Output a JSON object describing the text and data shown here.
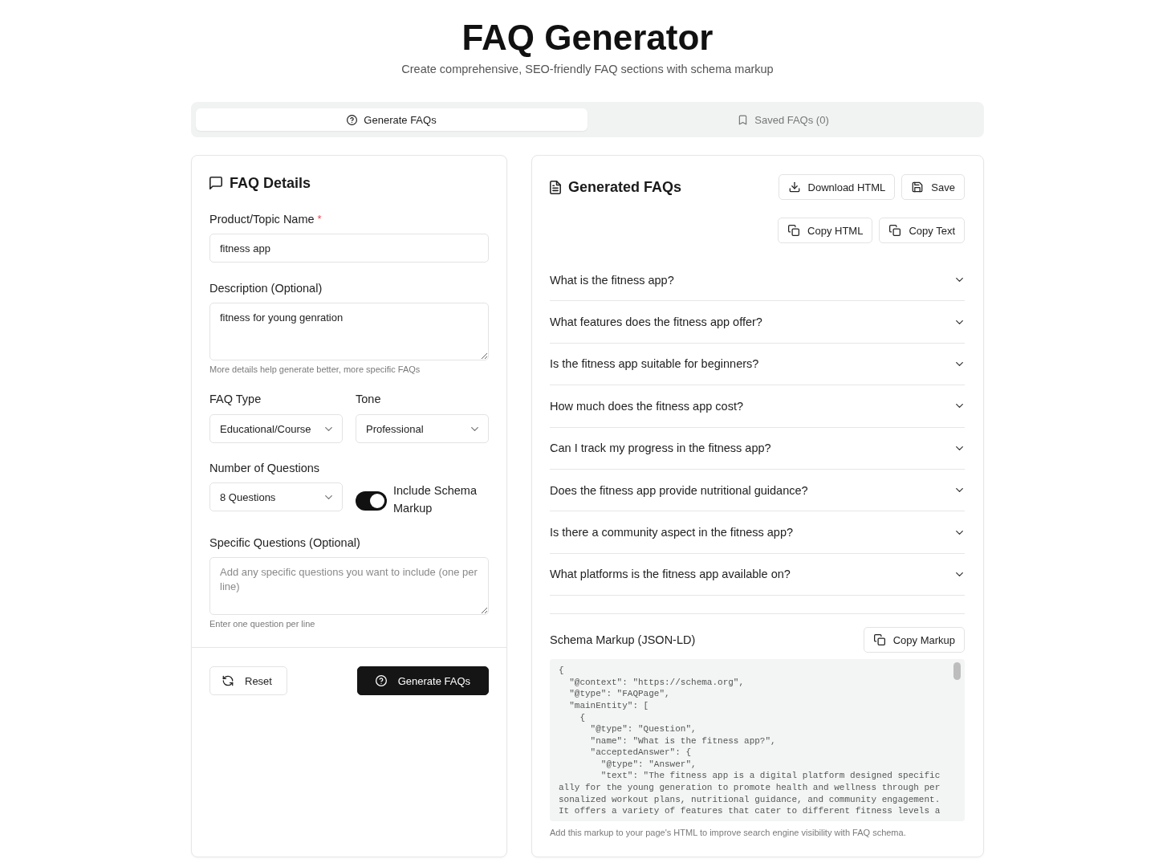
{
  "header": {
    "title": "FAQ Generator",
    "subtitle": "Create comprehensive, SEO-friendly FAQ sections with schema markup"
  },
  "tabs": [
    {
      "label": "Generate FAQs",
      "selected": true
    },
    {
      "label": "Saved FAQs (0)",
      "selected": false
    }
  ],
  "details_panel": {
    "title": "FAQ Details",
    "product": {
      "label": "Product/Topic Name",
      "required_mark": "*",
      "value": "fitness app"
    },
    "description": {
      "label": "Description (Optional)",
      "value": "fitness for young genration",
      "hint": "More details help generate better, more specific FAQs"
    },
    "faq_type": {
      "label": "FAQ Type",
      "value": "Educational/Course"
    },
    "tone": {
      "label": "Tone",
      "value": "Professional"
    },
    "question_count": {
      "label": "Number of Questions",
      "value": "8 Questions"
    },
    "schema_toggle": {
      "label": "Include Schema Markup",
      "on": true
    },
    "specific_questions": {
      "label": "Specific Questions (Optional)",
      "placeholder": "Add any specific questions you want to include (one per line)",
      "hint": "Enter one question per line"
    },
    "buttons": [
      {
        "label": "Reset",
        "kind": "secondary"
      },
      {
        "label": "Generate FAQs",
        "kind": "primary"
      }
    ]
  },
  "results_panel": {
    "title": "Generated FAQs",
    "action_rows": [
      [
        {
          "label": "Download HTML",
          "kind": "download"
        },
        {
          "label": "Save",
          "kind": "save"
        }
      ],
      [
        {
          "label": "Copy HTML",
          "kind": "copy"
        },
        {
          "label": "Copy Text",
          "kind": "copy"
        }
      ]
    ],
    "faqs": [
      {
        "question": "What is the fitness app?",
        "expanded": false
      },
      {
        "question": "What features does the fitness app offer?",
        "expanded": false
      },
      {
        "question": "Is the fitness app suitable for beginners?",
        "expanded": false
      },
      {
        "question": "How much does the fitness app cost?",
        "expanded": false
      },
      {
        "question": "Can I track my progress in the fitness app?",
        "expanded": false
      },
      {
        "question": "Does the fitness app provide nutritional guidance?",
        "expanded": false
      },
      {
        "question": "Is there a community aspect in the fitness app?",
        "expanded": false
      },
      {
        "question": "What platforms is the fitness app available on?",
        "expanded": false
      }
    ],
    "schema": {
      "title": "Schema Markup (JSON-LD)",
      "copy_button": "Copy Markup",
      "code_lines": [
        "{",
        "  \"@context\": \"https://schema.org\",",
        "  \"@type\": \"FAQPage\",",
        "  \"mainEntity\": [",
        "    {",
        "      \"@type\": \"Question\",",
        "      \"name\": \"What is the fitness app?\",",
        "      \"acceptedAnswer\": {",
        "        \"@type\": \"Answer\",",
        "        \"text\": \"The fitness app is a digital platform designed specific",
        "ally for the young generation to promote health and wellness through per",
        "sonalized workout plans, nutritional guidance, and community engagement.",
        "It offers a variety of features that cater to different fitness levels a"
      ],
      "note": "Add this markup to your page's HTML to improve search engine visibility with FAQ schema."
    }
  }
}
